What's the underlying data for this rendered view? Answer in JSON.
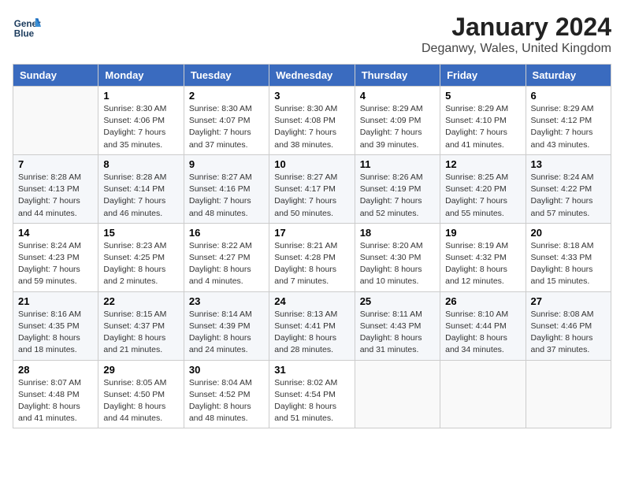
{
  "header": {
    "logo_line1": "General",
    "logo_line2": "Blue",
    "month": "January 2024",
    "location": "Deganwy, Wales, United Kingdom"
  },
  "weekdays": [
    "Sunday",
    "Monday",
    "Tuesday",
    "Wednesday",
    "Thursday",
    "Friday",
    "Saturday"
  ],
  "weeks": [
    [
      {
        "day": null,
        "info": null
      },
      {
        "day": "1",
        "info": "Sunrise: 8:30 AM\nSunset: 4:06 PM\nDaylight: 7 hours\nand 35 minutes."
      },
      {
        "day": "2",
        "info": "Sunrise: 8:30 AM\nSunset: 4:07 PM\nDaylight: 7 hours\nand 37 minutes."
      },
      {
        "day": "3",
        "info": "Sunrise: 8:30 AM\nSunset: 4:08 PM\nDaylight: 7 hours\nand 38 minutes."
      },
      {
        "day": "4",
        "info": "Sunrise: 8:29 AM\nSunset: 4:09 PM\nDaylight: 7 hours\nand 39 minutes."
      },
      {
        "day": "5",
        "info": "Sunrise: 8:29 AM\nSunset: 4:10 PM\nDaylight: 7 hours\nand 41 minutes."
      },
      {
        "day": "6",
        "info": "Sunrise: 8:29 AM\nSunset: 4:12 PM\nDaylight: 7 hours\nand 43 minutes."
      }
    ],
    [
      {
        "day": "7",
        "info": "Sunrise: 8:28 AM\nSunset: 4:13 PM\nDaylight: 7 hours\nand 44 minutes."
      },
      {
        "day": "8",
        "info": "Sunrise: 8:28 AM\nSunset: 4:14 PM\nDaylight: 7 hours\nand 46 minutes."
      },
      {
        "day": "9",
        "info": "Sunrise: 8:27 AM\nSunset: 4:16 PM\nDaylight: 7 hours\nand 48 minutes."
      },
      {
        "day": "10",
        "info": "Sunrise: 8:27 AM\nSunset: 4:17 PM\nDaylight: 7 hours\nand 50 minutes."
      },
      {
        "day": "11",
        "info": "Sunrise: 8:26 AM\nSunset: 4:19 PM\nDaylight: 7 hours\nand 52 minutes."
      },
      {
        "day": "12",
        "info": "Sunrise: 8:25 AM\nSunset: 4:20 PM\nDaylight: 7 hours\nand 55 minutes."
      },
      {
        "day": "13",
        "info": "Sunrise: 8:24 AM\nSunset: 4:22 PM\nDaylight: 7 hours\nand 57 minutes."
      }
    ],
    [
      {
        "day": "14",
        "info": "Sunrise: 8:24 AM\nSunset: 4:23 PM\nDaylight: 7 hours\nand 59 minutes."
      },
      {
        "day": "15",
        "info": "Sunrise: 8:23 AM\nSunset: 4:25 PM\nDaylight: 8 hours\nand 2 minutes."
      },
      {
        "day": "16",
        "info": "Sunrise: 8:22 AM\nSunset: 4:27 PM\nDaylight: 8 hours\nand 4 minutes."
      },
      {
        "day": "17",
        "info": "Sunrise: 8:21 AM\nSunset: 4:28 PM\nDaylight: 8 hours\nand 7 minutes."
      },
      {
        "day": "18",
        "info": "Sunrise: 8:20 AM\nSunset: 4:30 PM\nDaylight: 8 hours\nand 10 minutes."
      },
      {
        "day": "19",
        "info": "Sunrise: 8:19 AM\nSunset: 4:32 PM\nDaylight: 8 hours\nand 12 minutes."
      },
      {
        "day": "20",
        "info": "Sunrise: 8:18 AM\nSunset: 4:33 PM\nDaylight: 8 hours\nand 15 minutes."
      }
    ],
    [
      {
        "day": "21",
        "info": "Sunrise: 8:16 AM\nSunset: 4:35 PM\nDaylight: 8 hours\nand 18 minutes."
      },
      {
        "day": "22",
        "info": "Sunrise: 8:15 AM\nSunset: 4:37 PM\nDaylight: 8 hours\nand 21 minutes."
      },
      {
        "day": "23",
        "info": "Sunrise: 8:14 AM\nSunset: 4:39 PM\nDaylight: 8 hours\nand 24 minutes."
      },
      {
        "day": "24",
        "info": "Sunrise: 8:13 AM\nSunset: 4:41 PM\nDaylight: 8 hours\nand 28 minutes."
      },
      {
        "day": "25",
        "info": "Sunrise: 8:11 AM\nSunset: 4:43 PM\nDaylight: 8 hours\nand 31 minutes."
      },
      {
        "day": "26",
        "info": "Sunrise: 8:10 AM\nSunset: 4:44 PM\nDaylight: 8 hours\nand 34 minutes."
      },
      {
        "day": "27",
        "info": "Sunrise: 8:08 AM\nSunset: 4:46 PM\nDaylight: 8 hours\nand 37 minutes."
      }
    ],
    [
      {
        "day": "28",
        "info": "Sunrise: 8:07 AM\nSunset: 4:48 PM\nDaylight: 8 hours\nand 41 minutes."
      },
      {
        "day": "29",
        "info": "Sunrise: 8:05 AM\nSunset: 4:50 PM\nDaylight: 8 hours\nand 44 minutes."
      },
      {
        "day": "30",
        "info": "Sunrise: 8:04 AM\nSunset: 4:52 PM\nDaylight: 8 hours\nand 48 minutes."
      },
      {
        "day": "31",
        "info": "Sunrise: 8:02 AM\nSunset: 4:54 PM\nDaylight: 8 hours\nand 51 minutes."
      },
      {
        "day": null,
        "info": null
      },
      {
        "day": null,
        "info": null
      },
      {
        "day": null,
        "info": null
      }
    ]
  ]
}
